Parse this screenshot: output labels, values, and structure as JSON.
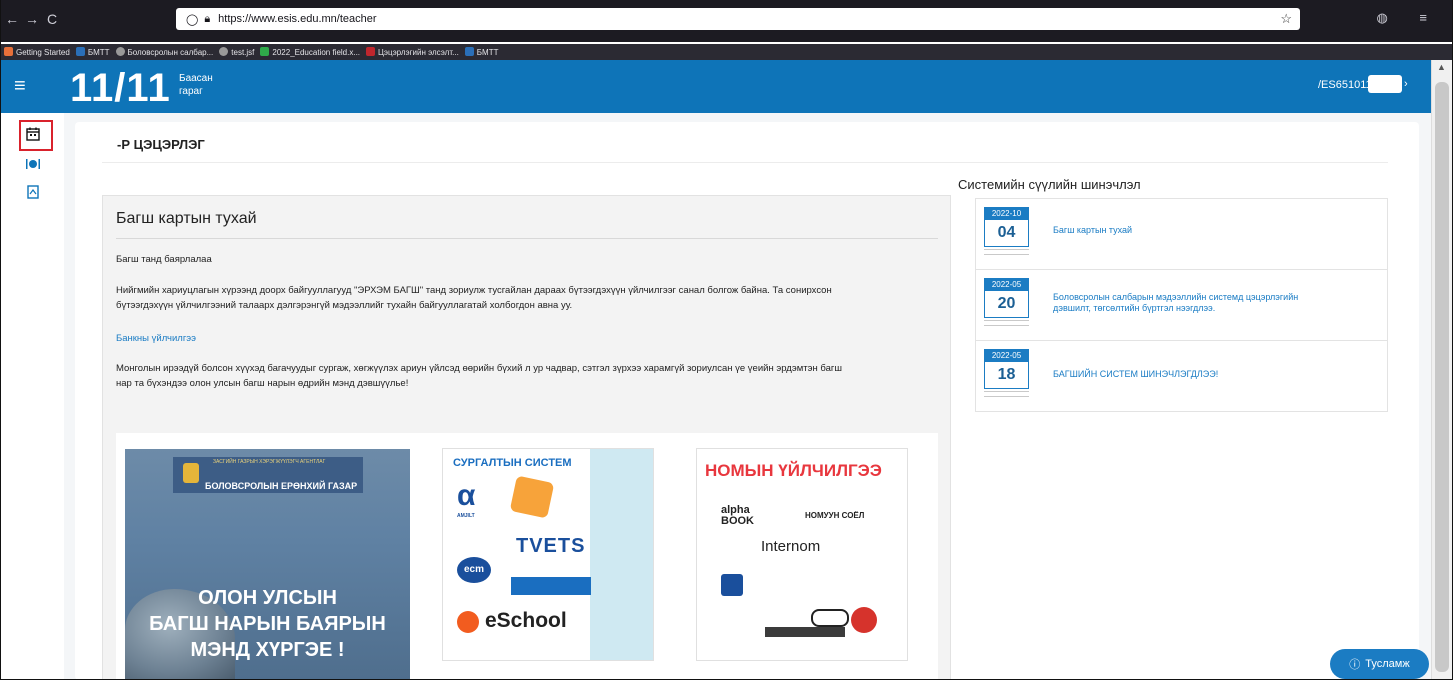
{
  "browser": {
    "url": "https://www.esis.edu.mn/teacher",
    "bookmarks": [
      "Getting Started",
      "БМТТ",
      "Боловсролын салбар...",
      "test.jsf",
      "2022_Education field.x...",
      "Цэцэрлэгийн элсэлт...",
      "БМТТ"
    ]
  },
  "header": {
    "date": "11/11",
    "day_line1": "Баасан",
    "day_line2": "гараг",
    "user_id": "/ES651011",
    "menu_icon": "hamburger-icon"
  },
  "sidebar": {
    "items": [
      {
        "icon": "calendar-icon"
      },
      {
        "icon": "food-icon"
      },
      {
        "icon": "document-icon"
      }
    ]
  },
  "main": {
    "org_name": "-Р ЦЭЦЭРЛЭГ",
    "about": {
      "title": "Багш картын тухай",
      "thanks": "Багш танд баярлалаа",
      "para1_line1": "Нийгмийн хариуцлагын хүрээнд доорх байгууллагууд \"ЭРХЭМ БАГШ\" танд зориулж тусгайлан дараах бүтээгдэхүүн үйлчилгээг санал болгож байна. Та сонирхсон",
      "para1_line2": "бүтээгдэхүүн үйлчилгээний талаарх дэлгэрэнгүй мэдээллийг тухайн байгууллагатай холбогдон авна уу.",
      "bank_link": "Банкны үйлчилгээ",
      "para2_line1": "Монголын ирээдүй болсон хүүхэд багачуудыг сургаж, хөгжүүлэх ариун үйлсэд өөрийн бүхий л ур чадвар, сэтгэл зүрхээ харамгүй зориулсан үе үеийн эрдэмтэн багш",
      "para2_line2": "нар та бүхэндээ олон улсын багш нарын өдрийн мэнд дэвшүүлье!"
    },
    "posters": {
      "p1_agency": "ЗАСГИЙН ГАЗРЫН ХЭРЭГЖҮҮЛЭГЧ АГЕНТЛАГ",
      "p1_org": "БОЛОВСРОЛЫН ЕРӨНХИЙ ГАЗАР",
      "p1_line1": "ОЛОН УЛСЫН",
      "p1_line2": "БАГШ НАРЫН БАЯРЫН",
      "p1_line3": "МЭНД ХҮРГЭЕ !",
      "p2_title": "СУРГАЛТЫН СИСТЕМ",
      "p2_logo_a": "AMJILT",
      "p2_logo_b": "TVETS",
      "p2_logo_c": "ecm",
      "p2_logo_d": "eSchool",
      "p3_title": "НОМЫН ҮЙЛЧИЛГЭЭ",
      "p3_logo_a": "alpha BOOK",
      "p3_logo_b": "НОМУУН СОЁЛ",
      "p3_logo_c": "Internom"
    }
  },
  "news": {
    "title": "Системийн сүүлийн шинэчлэл",
    "items": [
      {
        "ym": "2022-10",
        "day": "04",
        "text1": "Багш картын тухай",
        "text2": ""
      },
      {
        "ym": "2022-05",
        "day": "20",
        "text1": "Боловсролын салбарын мэдээллийн системд цэцэрлэгийн",
        "text2": "дэвшилт, төгсөлтийн бүртгэл нээгдлээ."
      },
      {
        "ym": "2022-05",
        "day": "18",
        "text1": "БАГШИЙН СИСТЕМ ШИНЭЧЛЭГДЛЭЭ!",
        "text2": ""
      }
    ]
  },
  "help": {
    "label": "Тусламж",
    "icon": "help-icon"
  },
  "colors": {
    "brand": "#0e74b8",
    "link": "#1a7cc4",
    "highlight": "#d9222c",
    "poster_red": "#e8373e"
  }
}
